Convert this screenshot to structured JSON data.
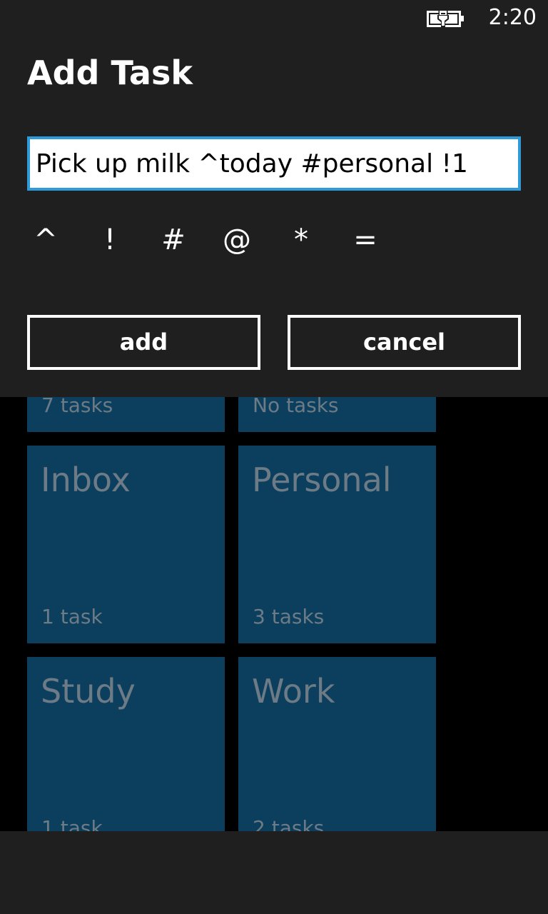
{
  "status_bar": {
    "time": "2:20",
    "battery_icon": "battery-charging-icon"
  },
  "tiles": [
    {
      "name": "",
      "count": "7 tasks"
    },
    {
      "name": "",
      "count": "No tasks"
    },
    {
      "name": "Inbox",
      "count": "1 task"
    },
    {
      "name": "Personal",
      "count": "3 tasks"
    },
    {
      "name": "Study",
      "count": "1 task"
    },
    {
      "name": "Work",
      "count": "2 tasks"
    }
  ],
  "dialog": {
    "title": "Add Task",
    "task_input_value": "Pick up milk ^today #personal !1",
    "symbols": [
      "^",
      "!",
      "#",
      "@",
      "*",
      "="
    ],
    "add_label": "add",
    "cancel_label": "cancel"
  },
  "colors": {
    "accent": "#2f9ad8",
    "tile_background": "#0c3f5d",
    "chrome_background": "#1f1f1f"
  }
}
